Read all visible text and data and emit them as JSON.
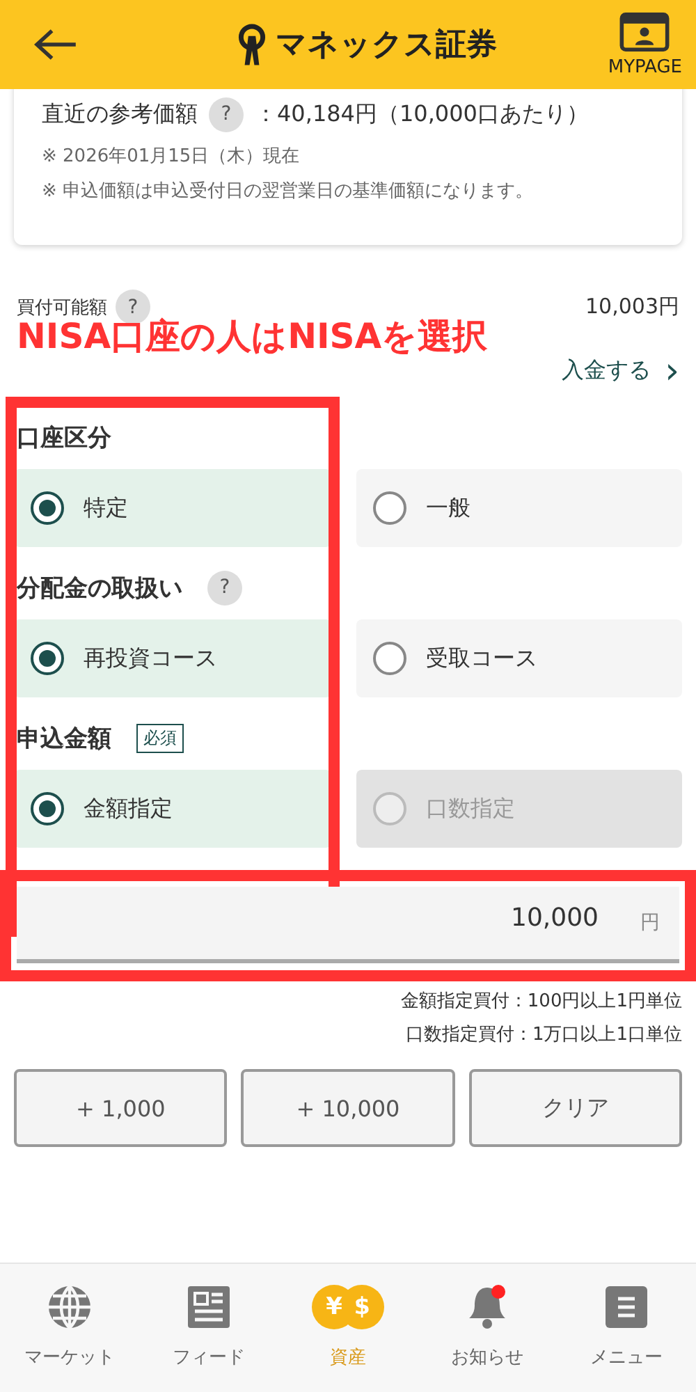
{
  "header": {
    "logo_text": "マネックス証券",
    "mypage_label": "MYPAGE"
  },
  "price_card": {
    "label": "直近の参考価額",
    "help": "?",
    "value": "：40,184円（10,000口あたり）",
    "notes": [
      "※ 2026年01月15日（木）現在",
      "※ 申込価額は申込受付日の翌営業日の基準価額になります。"
    ]
  },
  "buying_power": {
    "label": "買付可能額",
    "help": "?",
    "value": "10,003円",
    "deposit_link": "入金する",
    "link_arrow": "›"
  },
  "annotation": {
    "text": "NISA口座の人はNISAを選択"
  },
  "groups": [
    {
      "label": "口座区分",
      "options": [
        {
          "label": "特定",
          "selected": true,
          "disabled": false
        },
        {
          "label": "一般",
          "selected": false,
          "disabled": false
        }
      ]
    },
    {
      "label": "分配金の取扱い",
      "help": "?",
      "options": [
        {
          "label": "再投資コース",
          "selected": true,
          "disabled": false
        },
        {
          "label": "受取コース",
          "selected": false,
          "disabled": false
        }
      ]
    },
    {
      "label": "申込金額",
      "badge": "必須",
      "options": [
        {
          "label": "金額指定",
          "selected": true,
          "disabled": false
        },
        {
          "label": "口数指定",
          "selected": false,
          "disabled": true
        }
      ]
    }
  ],
  "amount_field": {
    "value": "10,000",
    "unit": "円"
  },
  "unit_notes": [
    "金額指定買付：100円以上1円単位",
    "口数指定買付：1万口以上1口単位"
  ],
  "quick_buttons": [
    "+ 1,000",
    "+ 10,000",
    "クリア"
  ],
  "nav": [
    {
      "kind": "globe",
      "label": "マーケット",
      "selected": false
    },
    {
      "kind": "feed",
      "label": "フィード",
      "selected": false
    },
    {
      "kind": "coins",
      "label": "資産",
      "selected": true,
      "yen": "¥",
      "dollar": "$"
    },
    {
      "kind": "bell",
      "label": "お知らせ",
      "selected": false,
      "badge": true
    },
    {
      "kind": "menu",
      "label": "メニュー",
      "selected": false
    }
  ]
}
